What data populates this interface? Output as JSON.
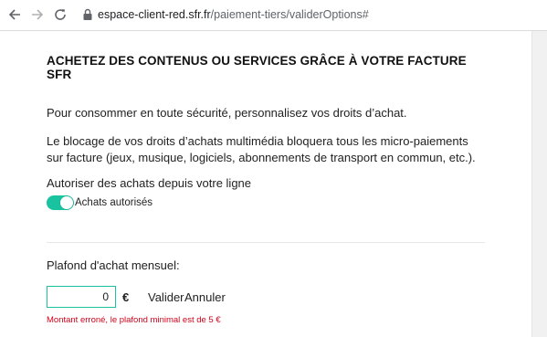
{
  "browser": {
    "url_domain": "espace-client-red.sfr.fr",
    "url_path": "/paiement-tiers/validerOptions#"
  },
  "page": {
    "heading": "ACHETEZ DES CONTENUS OU SERVICES GRÂCE À VOTRE FACTURE SFR",
    "intro": "Pour consommer en toute sécurité, personnalisez vos droits d’achat.",
    "block_info": "Le blocage de vos droits d’achats multimédia bloquera tous les micro-paiements sur facture (jeux, musique, logiciels, abonnements de transport en commun, etc.).",
    "autorise_label": "Autoriser des achats depuis votre ligne",
    "toggle_label": "Achats autorisés",
    "toggle_on": true,
    "plafond_label": "Plafond d'achat mensuel:",
    "amount_value": "0",
    "currency": "€",
    "valider_label": "Valider",
    "annuler_label": "Annuler",
    "error_message": "Montant erroné, le plafond minimal est de 5 €"
  },
  "colors": {
    "accent": "#19c3a0",
    "error": "#d0021b"
  }
}
